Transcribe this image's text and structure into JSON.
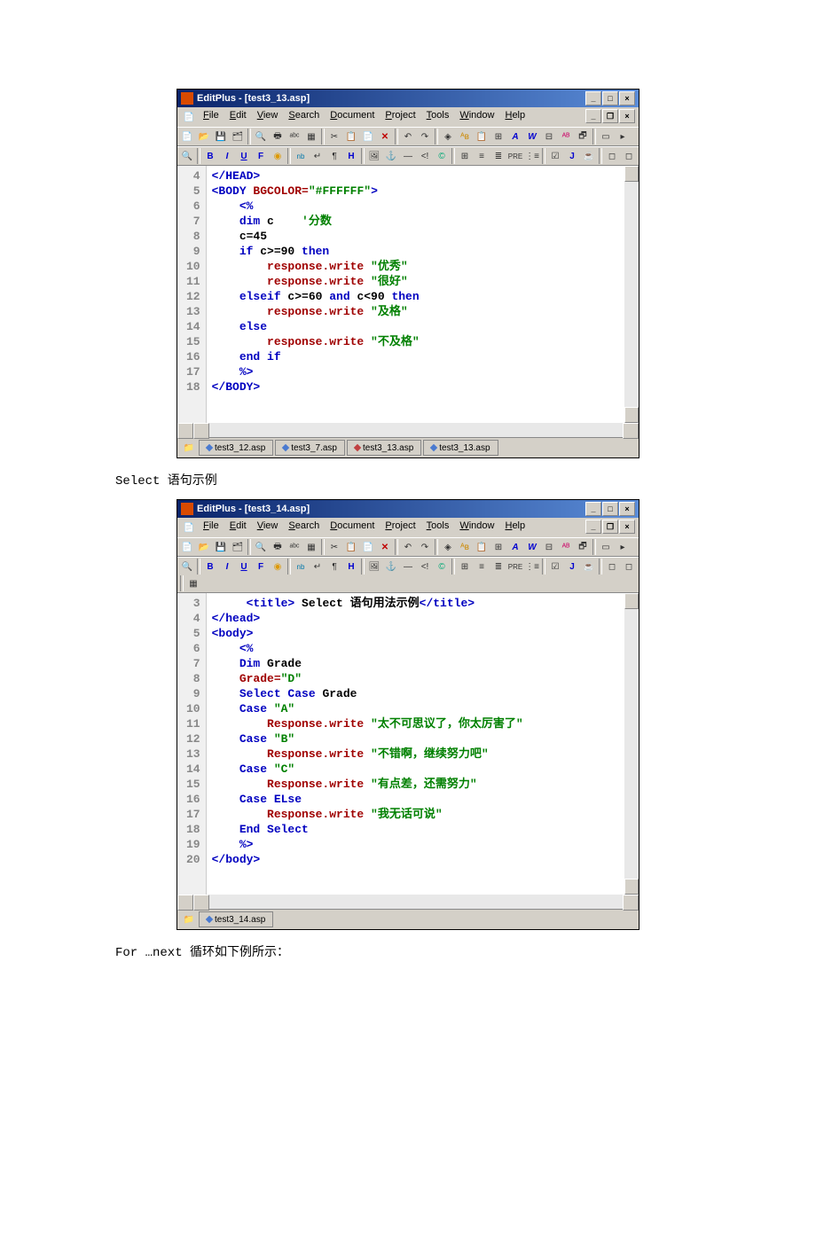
{
  "editor1": {
    "appTitle": "EditPlus - [test3_13.asp]",
    "menus": [
      "File",
      "Edit",
      "View",
      "Search",
      "Document",
      "Project",
      "Tools",
      "Window",
      "Help"
    ],
    "lineNums": [
      "4",
      "5",
      "6",
      "7",
      "8",
      "9",
      "10",
      "11",
      "12",
      "13",
      "14",
      "15",
      "16",
      "17",
      "18"
    ],
    "tabs": [
      {
        "name": "test3_12.asp",
        "color": "blue"
      },
      {
        "name": "test3_7.asp",
        "color": "blue"
      },
      {
        "name": "test3_13.asp",
        "color": "red"
      },
      {
        "name": "test3_13.asp",
        "color": "blue"
      }
    ],
    "code": {
      "l4": "</HEAD>",
      "l5a": "<BODY",
      "l5b": " BGCOLOR=",
      "l5c": "\"#FFFFFF\"",
      "l5d": ">",
      "l6": "    <%",
      "l7a": "    dim",
      "l7b": " c    ",
      "l7c": "'分数",
      "l8": "    c=45",
      "l9a": "    if",
      "l9b": " c>=90 ",
      "l9c": "then",
      "l10a": "        response.write ",
      "l10b": "\"优秀\"",
      "l11a": "        response.write ",
      "l11b": "\"很好\"",
      "l12a": "    elseif",
      "l12b": " c>=60 ",
      "l12c": "and",
      "l12d": " c<90 ",
      "l12e": "then",
      "l13a": "        response.write ",
      "l13b": "\"及格\"",
      "l14": "    else",
      "l15a": "        response.write ",
      "l15b": "\"不及格\"",
      "l16a": "    end",
      "l16b": " if",
      "l17": "    %>",
      "l18": "</BODY>"
    }
  },
  "caption1": "Select 语句示例",
  "editor2": {
    "appTitle": "EditPlus - [test3_14.asp]",
    "menus": [
      "File",
      "Edit",
      "View",
      "Search",
      "Document",
      "Project",
      "Tools",
      "Window",
      "Help"
    ],
    "lineNums": [
      "3",
      "4",
      "5",
      "6",
      "7",
      "8",
      "9",
      "10",
      "11",
      "12",
      "13",
      "14",
      "15",
      "16",
      "17",
      "18",
      "19",
      "20"
    ],
    "tabs": [
      {
        "name": "test3_14.asp",
        "color": "blue"
      }
    ],
    "code": {
      "l3a": "     <title>",
      "l3b": " Select 语句用法示例",
      "l3c": "</title>",
      "l4": "</head>",
      "l5": "<body>",
      "l6": "    <%",
      "l7a": "    Dim",
      "l7b": " Grade",
      "l8a": "    Grade=",
      "l8b": "\"D\"",
      "l9a": "    Select",
      "l9b": " Case",
      "l9c": " Grade",
      "l10a": "    Case ",
      "l10b": "\"A\"",
      "l11a": "        Response.write ",
      "l11b": "\"太不可思议了，你太厉害了\"",
      "l12a": "    Case ",
      "l12b": "\"B\"",
      "l13a": "        Response.write ",
      "l13b": "\"不错啊，继续努力吧\"",
      "l14a": "    Case ",
      "l14b": "\"C\"",
      "l15a": "        Response.write ",
      "l15b": "\"有点差，还需努力\"",
      "l16a": "    Case",
      "l16b": " ELse",
      "l17a": "        Response.write ",
      "l17b": "\"我无话可说\"",
      "l18a": "    End",
      "l18b": " Select",
      "l19": "    %>",
      "l20": "</body>"
    }
  },
  "caption2": "For …next 循环如下例所示："
}
